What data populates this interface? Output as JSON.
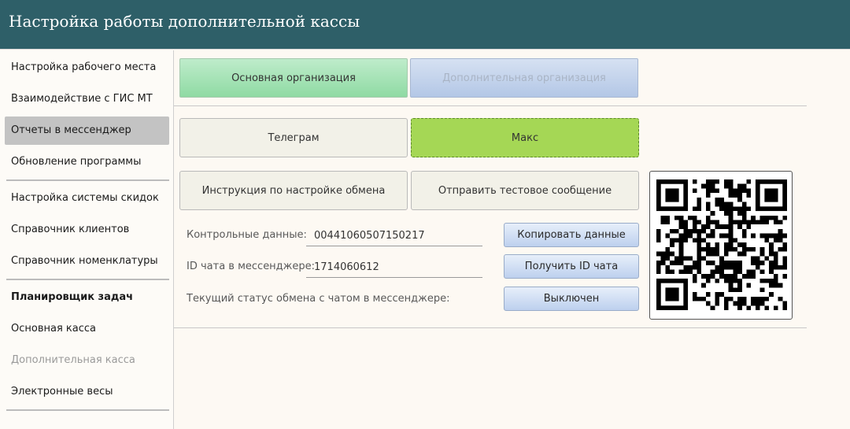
{
  "window": {
    "title": "Настройка работы дополнительной кассы"
  },
  "sidebar": {
    "items": [
      {
        "label": "Настройка рабочего места"
      },
      {
        "label": "Взаимодействие с ГИС МТ"
      },
      {
        "label": "Отчеты в мессенджер"
      },
      {
        "label": "Обновление программы"
      },
      {
        "label": "Настройка системы скидок"
      },
      {
        "label": "Справочник клиентов"
      },
      {
        "label": "Справочник номенклатуры"
      },
      {
        "label": "Планировщик задач"
      },
      {
        "label": "Основная касса"
      },
      {
        "label": "Дополнительная касса"
      },
      {
        "label": "Электронные весы"
      }
    ]
  },
  "main": {
    "org_tabs": {
      "main": "Основная организация",
      "additional": "Дополнительная организация"
    },
    "messenger_tabs": {
      "telegram": "Телеграм",
      "max": "Макс"
    },
    "instruction_button": "Инструкция по настройке обмена",
    "test_message_button": "Отправить тестовое сообщение",
    "control_data": {
      "label": "Контрольные данные:",
      "value": "00441060507150217",
      "button": "Копировать данные"
    },
    "chat_id": {
      "label": "ID чата в мессенджере:",
      "value": "1714060612",
      "button": "Получить ID чата"
    },
    "exchange_status": {
      "label": "Текущий статус обмена с чатом в мессенджере:",
      "button": "Выключен"
    },
    "qr_icon": "qr-code-icon"
  }
}
